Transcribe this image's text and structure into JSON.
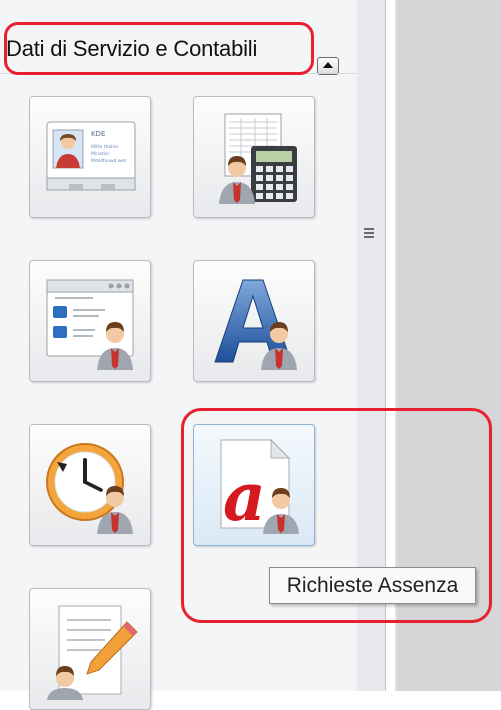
{
  "panel": {
    "title": "Dati di Servizio e Contabili",
    "collapse_icon": "chevron-up-icon"
  },
  "tiles": [
    {
      "name": "tile-anagrafica",
      "icon": "id-card-icon",
      "card_lines": [
        "KDE",
        "Mitte thaliss",
        "Minatjer",
        "Mdolltsuwd.wet"
      ]
    },
    {
      "name": "tile-contabilita",
      "icon": "calculator-icon"
    },
    {
      "name": "tile-dati-servizio",
      "icon": "form-list-icon"
    },
    {
      "name": "tile-font-a",
      "icon": "letter-a-icon"
    },
    {
      "name": "tile-presenze",
      "icon": "clock-history-icon"
    },
    {
      "name": "tile-richieste-assenza",
      "icon": "absence-document-icon",
      "hovered": true
    },
    {
      "name": "tile-modulistica",
      "icon": "edit-document-icon"
    }
  ],
  "tooltip": {
    "text": "Richieste Assenza"
  },
  "highlight_color": "#e8202f"
}
